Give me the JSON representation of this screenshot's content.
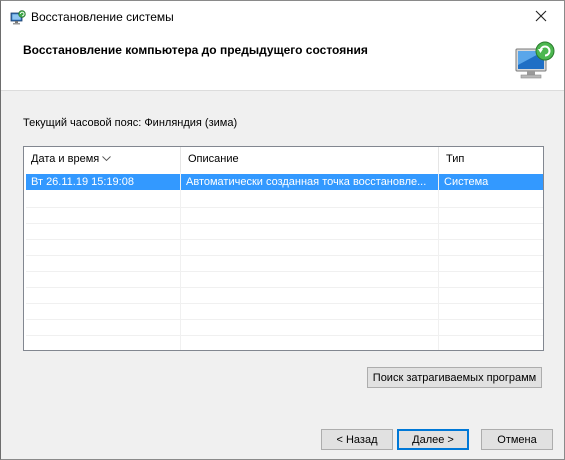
{
  "window": {
    "title": "Восстановление системы",
    "header_title": "Восстановление компьютера до предыдущего состояния"
  },
  "timezone_label": "Текущий часовой пояс: Финляндия (зима)",
  "table": {
    "columns": [
      "Дата и время",
      "Описание",
      "Тип"
    ],
    "rows": [
      {
        "date": "Вт 26.11.19 15:19:08",
        "description": "Автоматически созданная точка восстановле...",
        "type": "Система",
        "selected": true
      }
    ]
  },
  "buttons": {
    "scan": "Поиск затрагиваемых программ",
    "back": "< Назад",
    "next": "Далее >",
    "cancel": "Отмена"
  },
  "icons": {
    "title": "system-restore-icon",
    "header": "computer-restore-icon",
    "close": "close-icon",
    "sort": "sort-arrow-icon"
  },
  "colors": {
    "selection": "#3399ff",
    "default_button_border": "#0078d7"
  }
}
